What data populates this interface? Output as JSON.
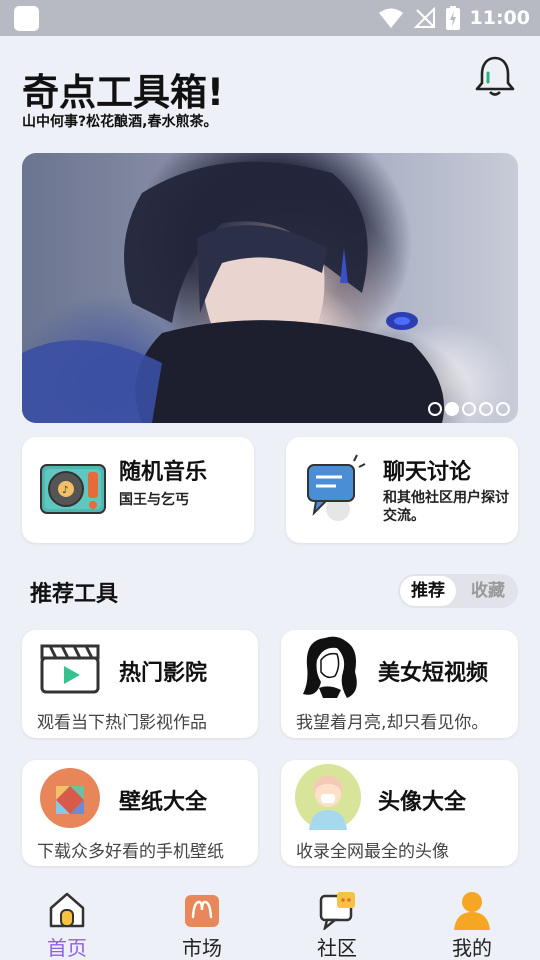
{
  "status_bar": {
    "time": "11:00"
  },
  "header": {
    "title": "奇点工具箱!",
    "subtitle": "山中何事?松花酿酒,春水煎茶。"
  },
  "banner": {
    "page_count": 5,
    "active_index": 1
  },
  "feature_cards": [
    {
      "title": "随机音乐",
      "desc": "国王与乞丐",
      "icon": "turntable-icon"
    },
    {
      "title": "聊天讨论",
      "desc": "和其他社区用户探讨交流。",
      "icon": "chat-icon"
    }
  ],
  "section": {
    "title": "推荐工具",
    "tabs": [
      {
        "label": "推荐",
        "active": true
      },
      {
        "label": "收藏",
        "active": false
      }
    ]
  },
  "tools": [
    {
      "title": "热门影院",
      "desc": "观看当下热门影视作品",
      "icon": "clapperboard-icon"
    },
    {
      "title": "美女短视频",
      "desc": "我望着月亮,却只看见你。",
      "icon": "woman-portrait-icon"
    },
    {
      "title": "壁纸大全",
      "desc": "下载众多好看的手机壁纸",
      "icon": "wallpaper-icon"
    },
    {
      "title": "头像大全",
      "desc": "收录全网最全的头像",
      "icon": "avatar-icon"
    }
  ],
  "nav": [
    {
      "label": "首页",
      "active": true,
      "icon": "home-icon"
    },
    {
      "label": "市场",
      "active": false,
      "icon": "market-icon"
    },
    {
      "label": "社区",
      "active": false,
      "icon": "community-icon"
    },
    {
      "label": "我的",
      "active": false,
      "icon": "profile-icon"
    }
  ],
  "colors": {
    "accent": "#8f5fe8",
    "background": "#eef0f7",
    "card": "#ffffff"
  }
}
